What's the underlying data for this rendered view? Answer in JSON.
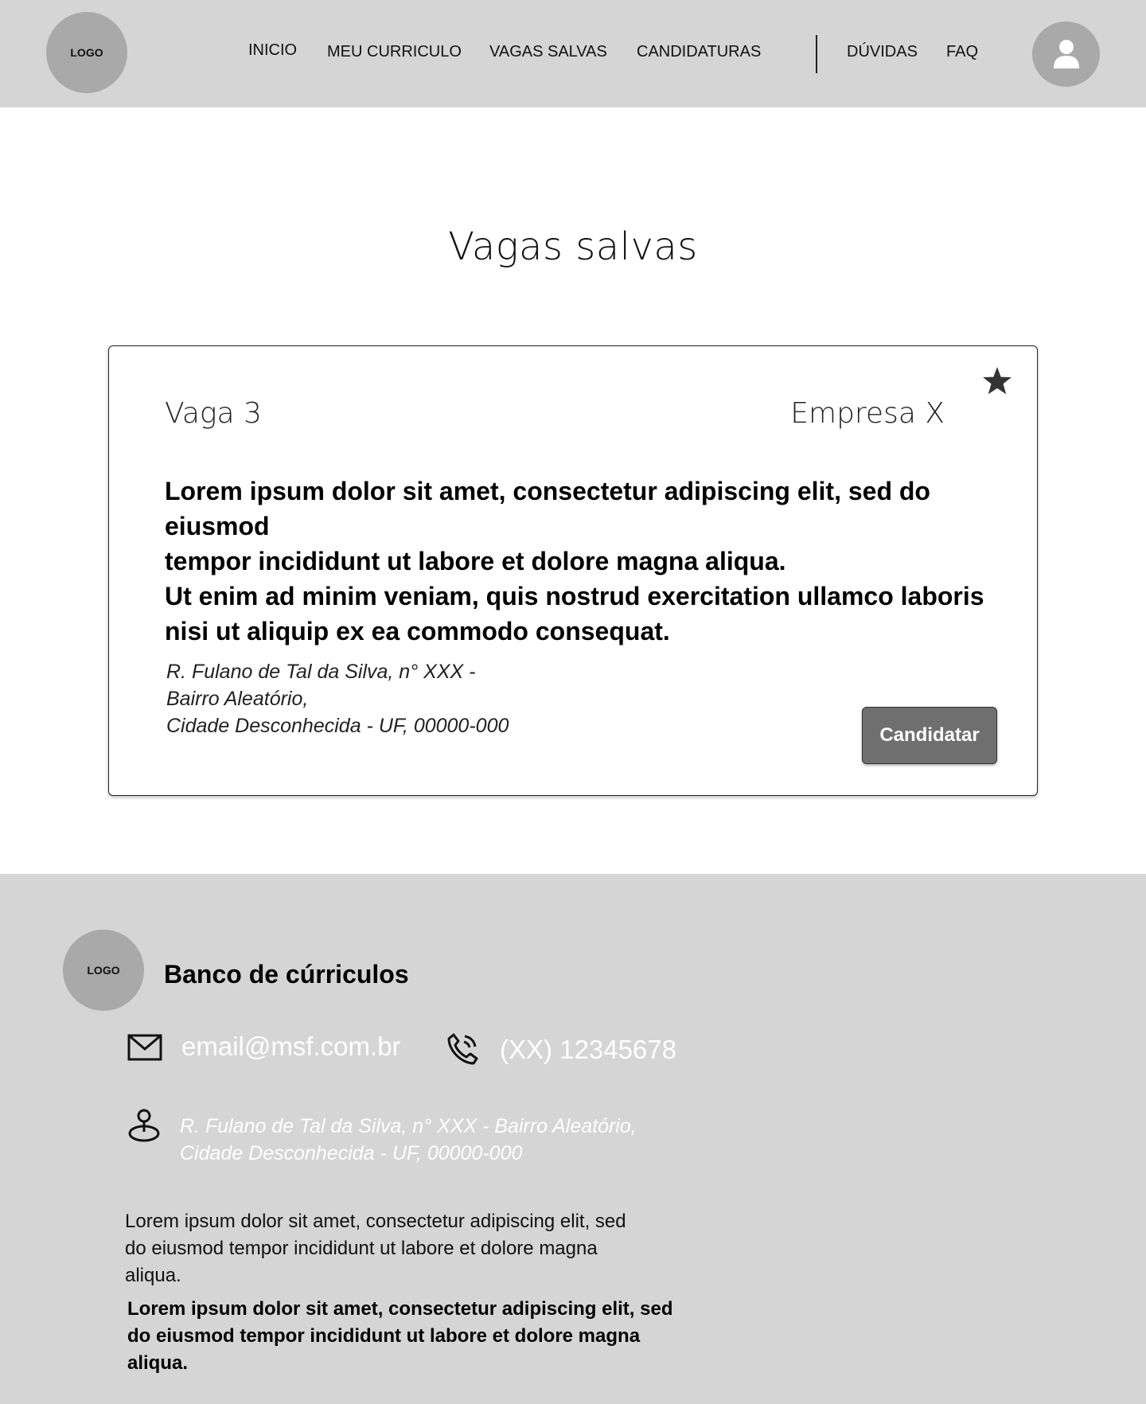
{
  "header": {
    "logo": "LOGO",
    "nav": [
      "INICIO",
      "MEU CURRICULO",
      "VAGAS SALVAS",
      "CANDIDATURAS",
      "DÚVIDAS",
      "FAQ"
    ],
    "avatar_icon": "user-icon"
  },
  "main": {
    "title": "Vagas salvas",
    "card": {
      "job_title": "Vaga 3",
      "company": "Empresa X",
      "star_icon": "star-icon",
      "description_lines": [
        "Lorem ipsum dolor sit amet, consectetur adipiscing elit, sed do eiusmod",
        "tempor incididunt ut labore et dolore magna aliqua.",
        "Ut enim ad minim veniam, quis nostrud exercitation ullamco laboris",
        "nisi ut aliquip ex ea commodo consequat."
      ],
      "address_lines": [
        "R. Fulano de Tal da Silva, n° XXX -",
        "Bairro Aleatório,",
        "Cidade Desconhecida - UF, 00000-000"
      ],
      "apply_label": "Candidatar"
    }
  },
  "footer": {
    "logo": "LOGO",
    "brand": "Banco de cúrriculos",
    "email": "email@msf.com.br",
    "phone": "(XX) 12345678",
    "address_lines": [
      "R. Fulano de Tal da Silva, n° XXX - Bairro Aleatório,",
      "Cidade Desconhecida - UF, 00000-000"
    ],
    "paragraph_lines": [
      "Lorem ipsum dolor sit amet, consectetur adipiscing elit, sed",
      "do eiusmod tempor incididunt ut labore et dolore magna",
      "aliqua."
    ],
    "paragraph_bold_lines": [
      "Lorem ipsum dolor sit amet, consectetur adipiscing elit, sed",
      "do eiusmod tempor incididunt ut labore et dolore magna",
      "aliqua."
    ],
    "icons": [
      "mail-icon",
      "phone-icon",
      "location-pin-icon"
    ]
  }
}
